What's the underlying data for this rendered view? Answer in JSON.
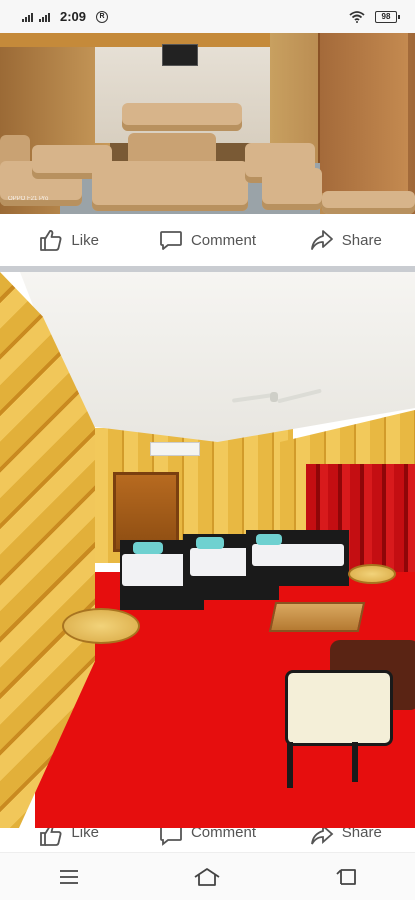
{
  "status_bar": {
    "time": "2:09",
    "r_badge": "R",
    "battery_level": "98"
  },
  "post1": {
    "photo_caption": "OPPO F21 Pro",
    "actions": {
      "like_label": "Like",
      "comment_label": "Comment",
      "share_label": "Share"
    }
  },
  "post2": {
    "actions": {
      "like_label": "Like",
      "comment_label": "Comment",
      "share_label": "Share"
    }
  },
  "icons": {
    "like": "thumbs-up-icon",
    "comment": "comment-icon",
    "share": "share-arrow-icon",
    "menu": "menu-icon",
    "home": "home-icon",
    "back": "back-icon"
  },
  "colors": {
    "action_text": "#555555",
    "divider": "#c9ccd1",
    "carpet": "#e60e0e"
  }
}
